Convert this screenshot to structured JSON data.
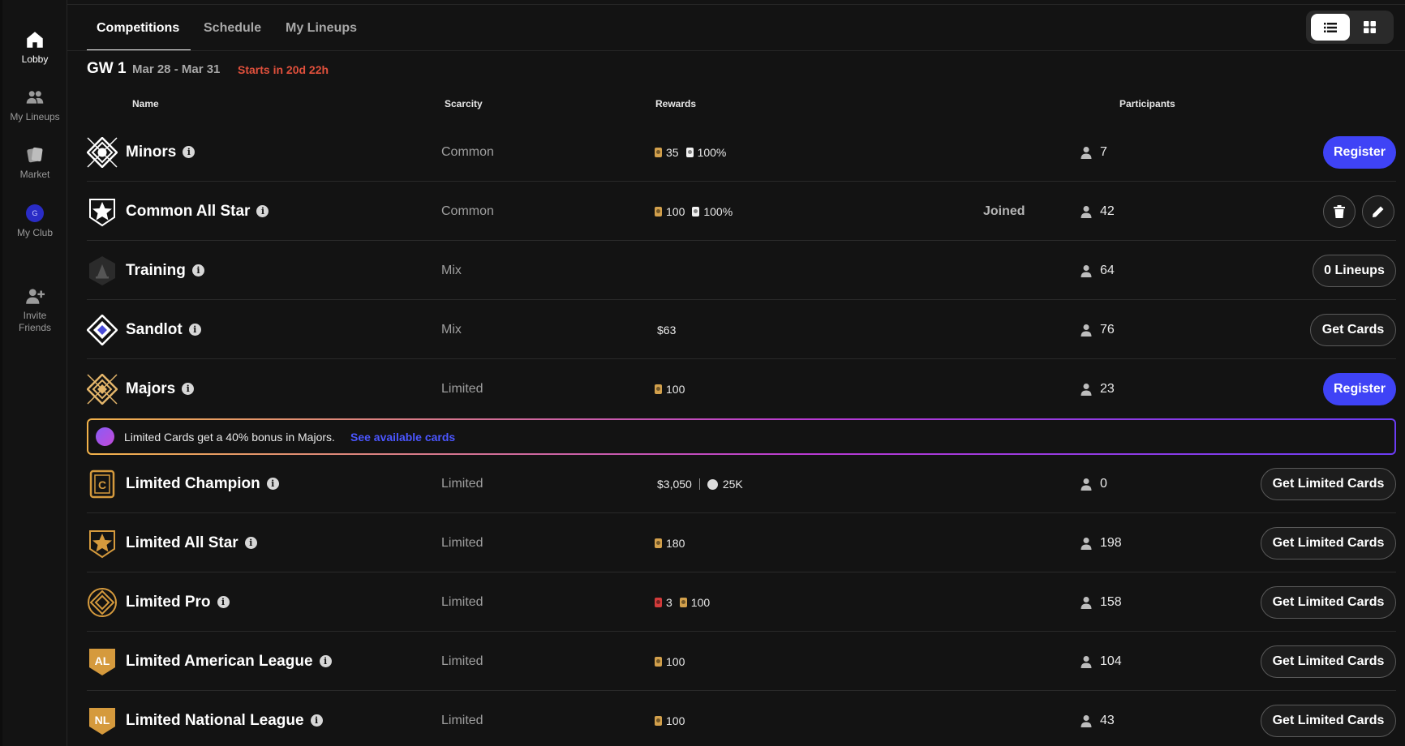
{
  "sidebar": {
    "items": [
      {
        "label": "Lobby",
        "icon": "home-icon"
      },
      {
        "label": "My Lineups",
        "icon": "users-icon"
      },
      {
        "label": "Market",
        "icon": "cards-icon"
      },
      {
        "label": "My Club",
        "icon": "club-avatar-icon",
        "avatar_letter": "G"
      },
      {
        "label": "Invite\nFriends",
        "icon": "add-user-icon"
      }
    ]
  },
  "tabs": [
    "Competitions",
    "Schedule",
    "My Lineups"
  ],
  "gameweek": {
    "title": "GW 1",
    "dates": "Mar 28 - Mar 31",
    "starts": "Starts in 20d 22h"
  },
  "columns": {
    "name": "Name",
    "scarcity": "Scarcity",
    "rewards": "Rewards",
    "participants": "Participants"
  },
  "bonus": {
    "text": "Limited Cards get a 40% bonus in Majors.",
    "link": "See available cards"
  },
  "competitions": [
    {
      "name": "Minors",
      "scarcity": "Common",
      "rewards": [
        {
          "type": "card-gold",
          "value": "35"
        },
        {
          "type": "card-white",
          "value": "100%"
        }
      ],
      "joined": "",
      "participants": "7",
      "action": "Register",
      "action_style": "primary"
    },
    {
      "name": "Common All Star",
      "scarcity": "Common",
      "rewards": [
        {
          "type": "card-gold",
          "value": "100"
        },
        {
          "type": "card-white",
          "value": "100%"
        }
      ],
      "joined": "Joined",
      "participants": "42",
      "action": "",
      "action_style": "edit-delete"
    },
    {
      "name": "Training",
      "scarcity": "Mix",
      "rewards": [],
      "joined": "",
      "participants": "64",
      "action": "0 Lineups",
      "action_style": "outline"
    },
    {
      "name": "Sandlot",
      "scarcity": "Mix",
      "rewards": [
        {
          "type": "text",
          "value": "$63"
        }
      ],
      "joined": "",
      "participants": "76",
      "action": "Get Cards",
      "action_style": "outline"
    },
    {
      "name": "Majors",
      "scarcity": "Limited",
      "rewards": [
        {
          "type": "card-gold",
          "value": "100"
        }
      ],
      "joined": "",
      "participants": "23",
      "action": "Register",
      "action_style": "primary"
    },
    {
      "name": "Limited Champion",
      "scarcity": "Limited",
      "rewards": [
        {
          "type": "text",
          "value": "$3,050"
        },
        {
          "type": "separator"
        },
        {
          "type": "coin",
          "value": "25K"
        }
      ],
      "joined": "",
      "participants": "0",
      "action": "Get Limited Cards",
      "action_style": "outline"
    },
    {
      "name": "Limited All Star",
      "scarcity": "Limited",
      "rewards": [
        {
          "type": "card-gold",
          "value": "180"
        }
      ],
      "joined": "",
      "participants": "198",
      "action": "Get Limited Cards",
      "action_style": "outline"
    },
    {
      "name": "Limited Pro",
      "scarcity": "Limited",
      "rewards": [
        {
          "type": "card-red",
          "value": "3"
        },
        {
          "type": "card-gold",
          "value": "100"
        }
      ],
      "joined": "",
      "participants": "158",
      "action": "Get Limited Cards",
      "action_style": "outline"
    },
    {
      "name": "Limited American League",
      "scarcity": "Limited",
      "rewards": [
        {
          "type": "card-gold",
          "value": "100"
        }
      ],
      "joined": "",
      "participants": "104",
      "action": "Get Limited Cards",
      "action_style": "outline"
    },
    {
      "name": "Limited National League",
      "scarcity": "Limited",
      "rewards": [
        {
          "type": "card-gold",
          "value": "100"
        }
      ],
      "joined": "",
      "participants": "43",
      "action": "Get Limited Cards",
      "action_style": "outline"
    }
  ],
  "badges": {
    "al": "AL",
    "nl": "NL",
    "champion": "C"
  },
  "colors": {
    "primary": "#3f43f6",
    "starts": "#e0503c",
    "link": "#4b56ff",
    "gold": "#d2a04c"
  }
}
